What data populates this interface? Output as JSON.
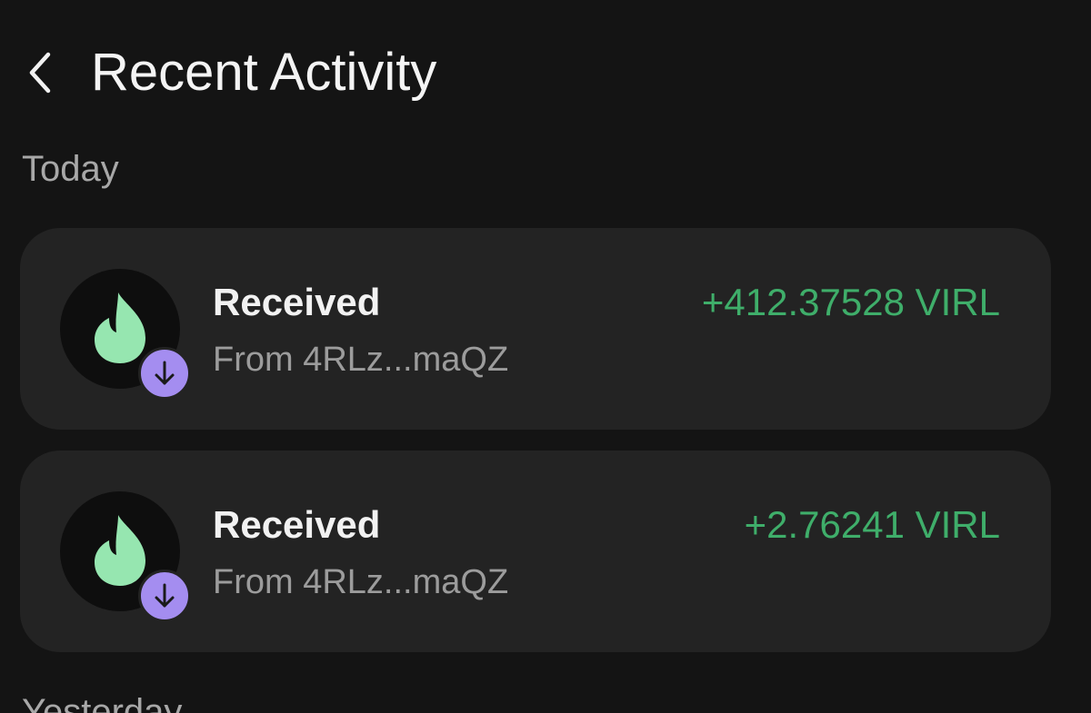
{
  "header": {
    "back_icon": "chevron-left-icon",
    "title": "Recent Activity"
  },
  "sections": [
    {
      "label": "Today",
      "transactions": [
        {
          "title": "Received",
          "subtitle": "From 4RLz...maQZ",
          "amount": "+412.37528 VIRL",
          "token_icon": "flame-icon",
          "badge_icon": "arrow-down-icon"
        },
        {
          "title": "Received",
          "subtitle": "From 4RLz...maQZ",
          "amount": "+2.76241 VIRL",
          "token_icon": "flame-icon",
          "badge_icon": "arrow-down-icon"
        }
      ]
    },
    {
      "label": "Yesterday"
    }
  ],
  "colors": {
    "background": "#141414",
    "card": "#232323",
    "amount_positive": "#3fae6a",
    "token_flame": "#96e6b0",
    "badge": "#a48df0"
  }
}
